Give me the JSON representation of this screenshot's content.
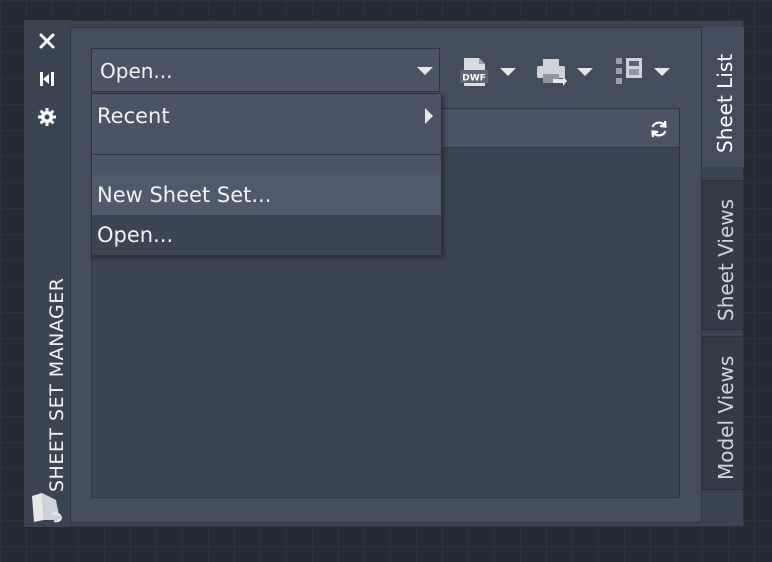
{
  "window": {
    "title": "SHEET SET MANAGER",
    "close_icon": "close-icon",
    "pin_icon": "auto-hide-icon",
    "settings_icon": "gear-icon"
  },
  "toolbar": {
    "combo_value": "Open...",
    "publish_dwf_label": "DWF",
    "publish_dwf_icon": "publish-dwf-icon",
    "plot_icon": "print-icon",
    "sheet_selections_icon": "sheet-selections-icon"
  },
  "list": {
    "refresh_icon": "refresh-icon"
  },
  "menu": {
    "items": [
      {
        "label": "Recent",
        "has_submenu": true
      },
      {
        "label": "New Sheet Set..."
      },
      {
        "label": "Open..."
      }
    ]
  },
  "tabs": [
    {
      "label": "Sheet List",
      "active": true
    },
    {
      "label": "Sheet Views",
      "active": false
    },
    {
      "label": "Model Views",
      "active": false
    }
  ],
  "colors": {
    "panel": "#3b4453",
    "content": "#434d5e",
    "text": "#f2f2f2",
    "canvas": "#222a33"
  }
}
